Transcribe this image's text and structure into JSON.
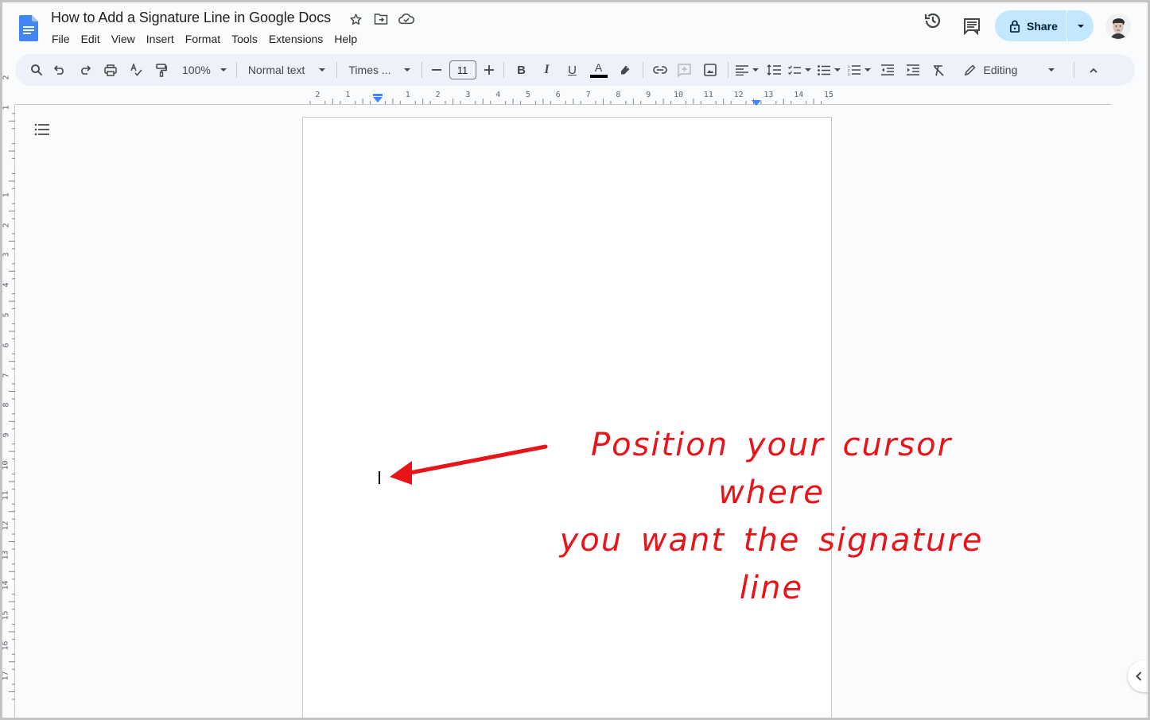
{
  "app": {
    "doc_title": "How to Add a Signature Line in Google Docs",
    "logo_icon": "google-docs-icon"
  },
  "title_icons": [
    "star-icon",
    "move-to-folder-icon",
    "cloud-saved-icon"
  ],
  "menu": [
    "File",
    "Edit",
    "View",
    "Insert",
    "Format",
    "Tools",
    "Extensions",
    "Help"
  ],
  "header_right": {
    "history_icon": "version-history-icon",
    "comments_icon": "comments-icon",
    "share_label": "Share",
    "share_icon": "lock-icon",
    "avatar": "user-avatar"
  },
  "toolbar": {
    "zoom": "100%",
    "style": "Normal text",
    "font": "Times ...",
    "font_size": "11",
    "mode": "Editing",
    "text_color": "#000000"
  },
  "ruler": {
    "horizontal_left": [
      "2",
      "1"
    ],
    "horizontal": [
      "1",
      "2",
      "3",
      "4",
      "5",
      "6",
      "7",
      "8",
      "9",
      "10",
      "11",
      "12",
      "13",
      "14",
      "15"
    ],
    "vertical_top": [
      "2",
      "1"
    ],
    "vertical": [
      "1",
      "2",
      "3",
      "4",
      "5",
      "6",
      "7",
      "8",
      "9",
      "10",
      "11",
      "12",
      "13",
      "14",
      "15",
      "16",
      "17"
    ]
  },
  "annotation": {
    "line1": "Position your cursor where",
    "line2": "you want the signature",
    "line3": "line",
    "color": "#e8141a"
  }
}
